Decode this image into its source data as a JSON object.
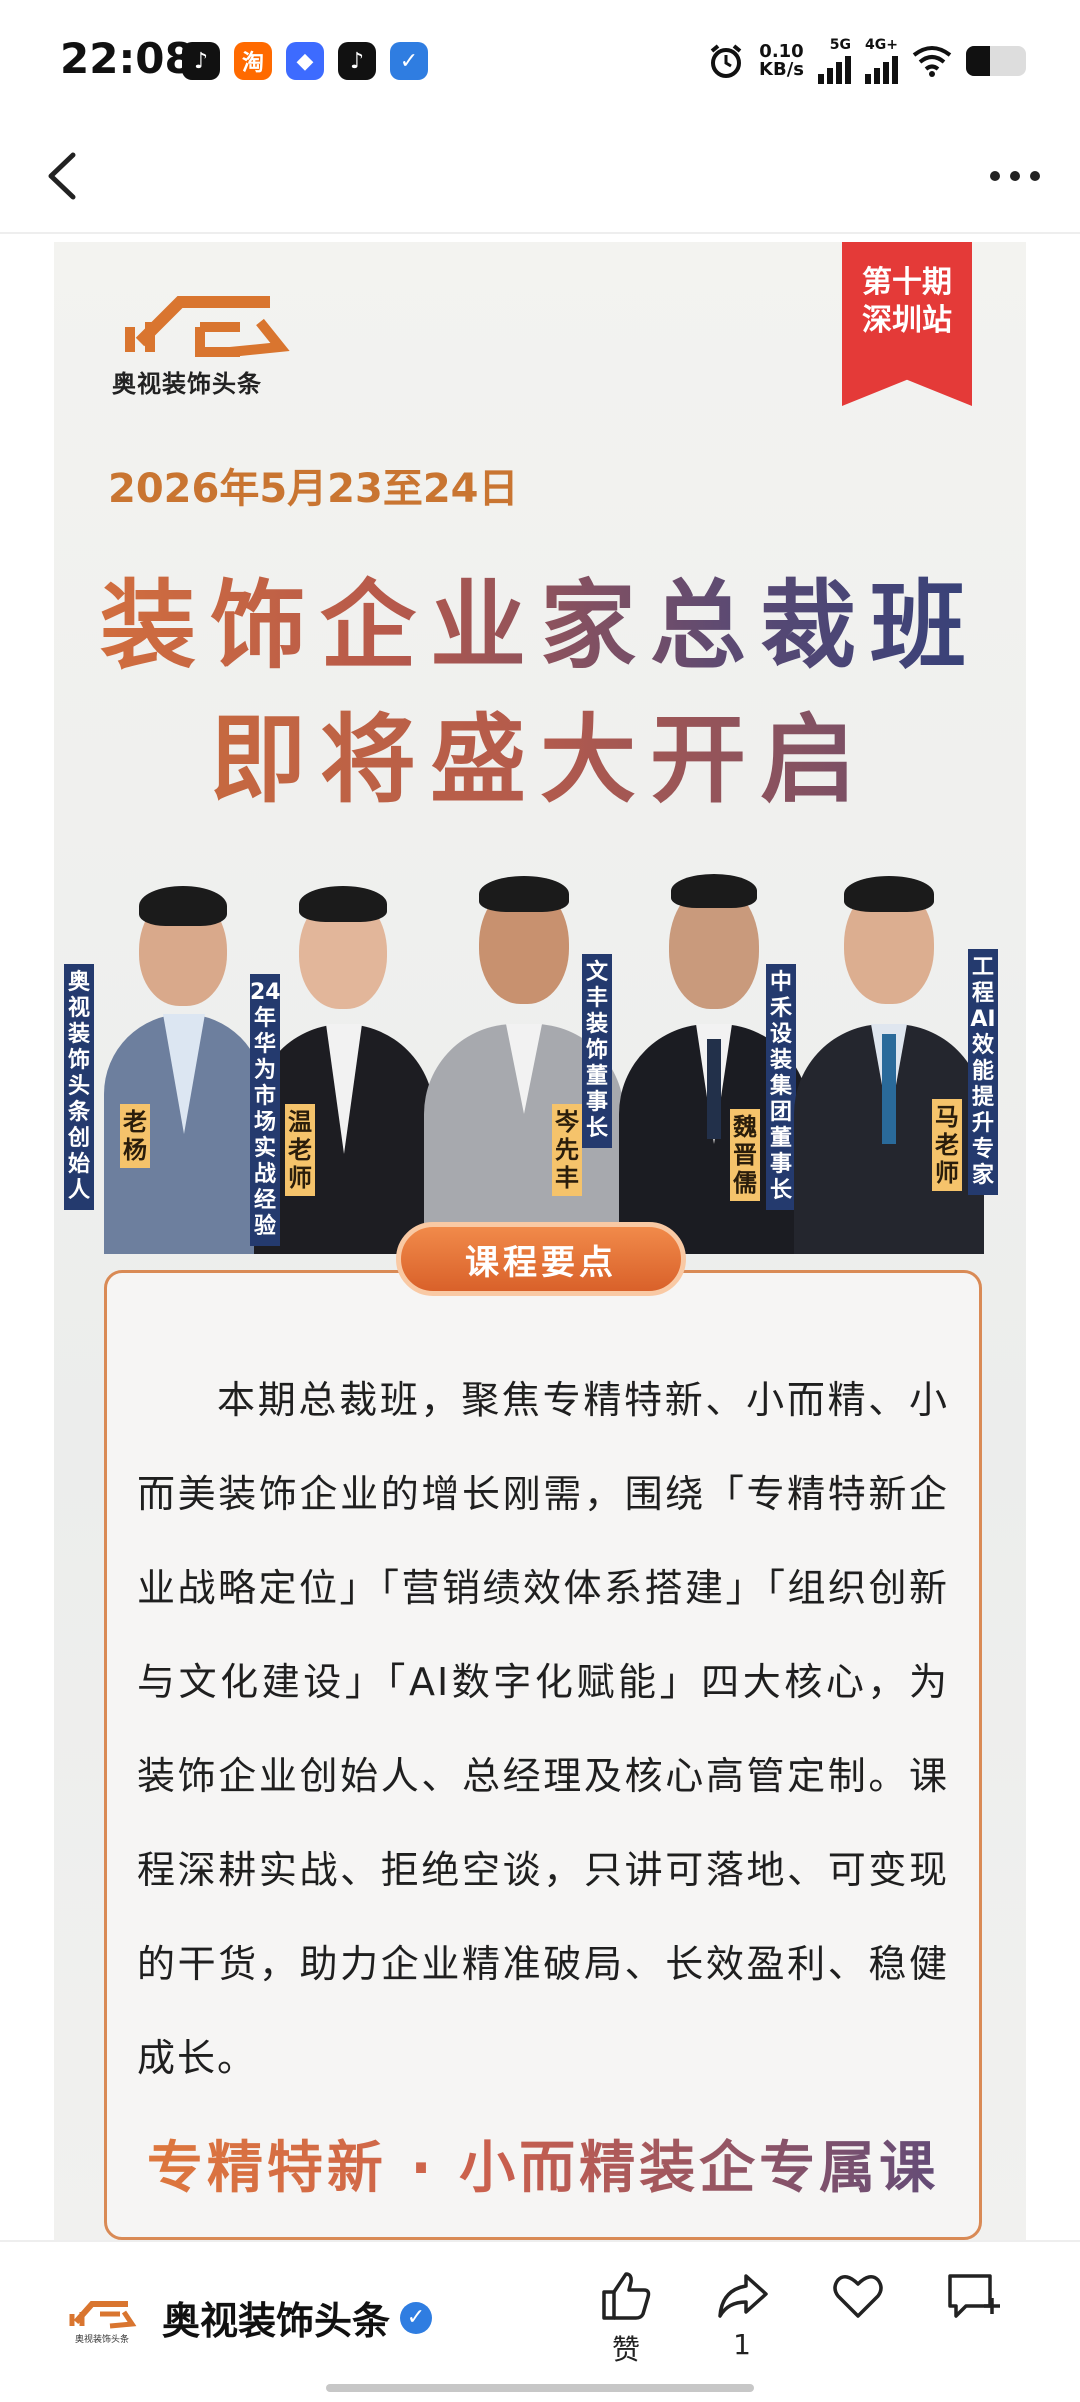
{
  "status_bar": {
    "time": "22:08",
    "app_icons": [
      {
        "name": "tiktok-app-icon",
        "glyph": "♪",
        "color": "#111111"
      },
      {
        "name": "taobao-app-icon",
        "glyph": "淘",
        "color": "#ff6a00"
      },
      {
        "name": "app-icon-blue",
        "glyph": "◆",
        "color": "#3d6bff"
      },
      {
        "name": "tiktok-app-icon-2",
        "glyph": "♪",
        "color": "#111111"
      },
      {
        "name": "app-icon-feishu",
        "glyph": "✓",
        "color": "#2f7de1"
      }
    ],
    "net_speed_value": "0.10",
    "net_speed_unit": "KB/s",
    "network_1": "5G",
    "network_2": "4G+",
    "battery_level": 0.4
  },
  "nav": {
    "back_icon": "chevron-left-icon",
    "more_icon": "more-horizontal-icon"
  },
  "poster": {
    "brand_name": "奥视装饰头条",
    "ribbon_line1": "第十期",
    "ribbon_line2": "深圳站",
    "date": "2026年5月23至24日",
    "headline_line1": "装饰企业家总裁班",
    "headline_line2": "即将盛大开启",
    "speakers": [
      {
        "title": "奥视装饰头条创始人",
        "name": "老杨"
      },
      {
        "title": "24年华为市场实战经验",
        "name": "温老师"
      },
      {
        "title": "文丰装饰董事长",
        "name": "岑先丰"
      },
      {
        "title": "中禾设装集团董事长",
        "name": "魏晋儒"
      },
      {
        "title": "工程AI效能提升专家",
        "name": "马老师"
      }
    ],
    "section_title": "课程要点",
    "course_paragraph": "本期总裁班，聚焦专精特新、小而精、小而美装饰企业的增长刚需，围绕「专精特新企业战略定位」「营销绩效体系搭建」「组织创新与文化建设」「AI数字化赋能」四大核心，为装饰企业创始人、总经理及核心高管定制。课程深耕实战、拒绝空谈，只讲可落地、可变现的干货，助力企业精准破局、长效盈利、稳健成长。",
    "slogan": "专精特新 · 小而精装企专属课"
  },
  "bottom_bar": {
    "account_name": "奥视装饰头条",
    "logo_text": "奥视装饰头条",
    "like_label": "赞",
    "share_count": "1",
    "verified_icon": "verified-badge-icon"
  }
}
